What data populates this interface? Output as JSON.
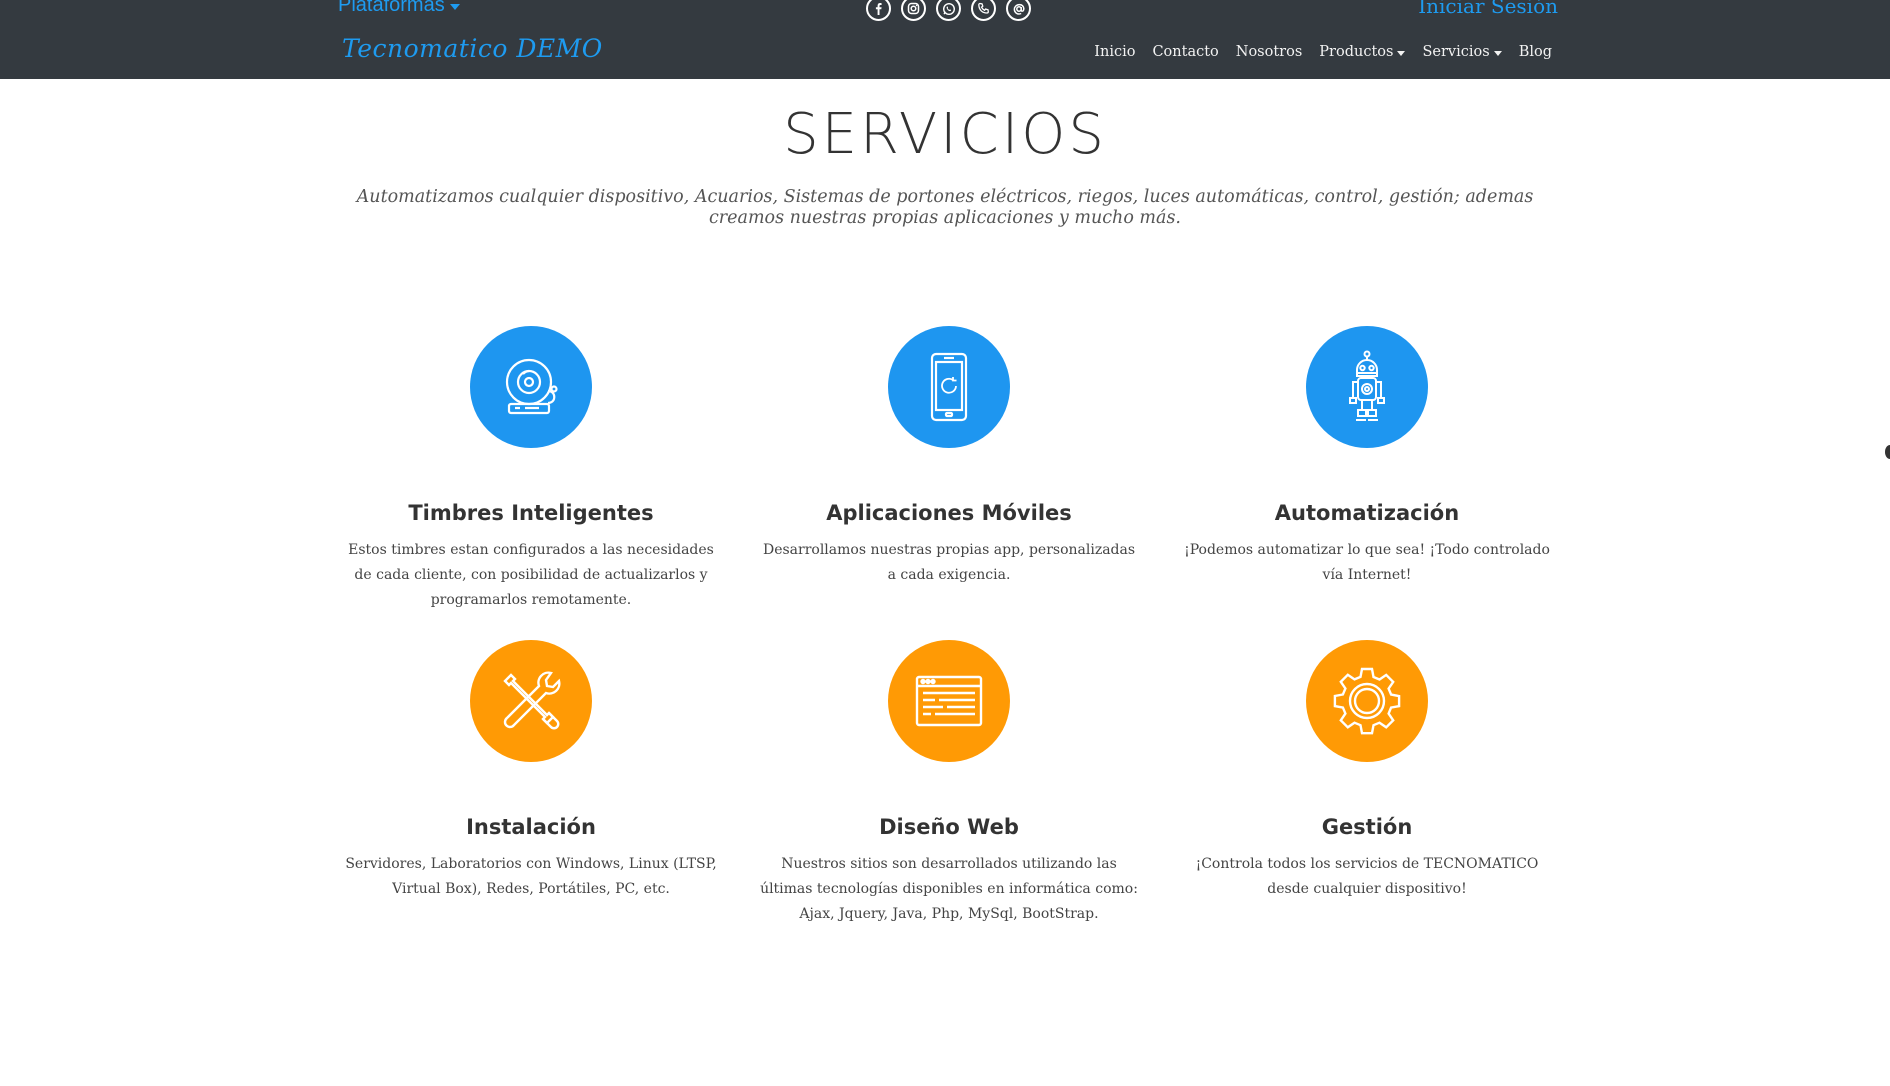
{
  "header": {
    "plataformas_label": "Plataformas",
    "login_label": "Iniciar Sesión",
    "brand": "Tecnomatico DEMO",
    "social_icons": [
      "facebook-icon",
      "instagram-icon",
      "whatsapp-icon",
      "phone-icon",
      "email-icon"
    ],
    "nav": [
      {
        "label": "Inicio",
        "dropdown": false
      },
      {
        "label": "Contacto",
        "dropdown": false
      },
      {
        "label": "Nosotros",
        "dropdown": false
      },
      {
        "label": "Productos",
        "dropdown": true
      },
      {
        "label": "Servicios",
        "dropdown": true
      },
      {
        "label": "Blog",
        "dropdown": false
      }
    ]
  },
  "main": {
    "title": "SERVICIOS",
    "intro": "Automatizamos cualquier dispositivo, Acuarios, Sistemas de portones eléctricos, riegos, luces automáticas, control, gestión; ademas creamos nuestras propias aplicaciones y mucho más."
  },
  "services": [
    {
      "icon": "bell-icon",
      "color": "#1e96f0",
      "title": "Timbres Inteligentes",
      "desc": "Estos timbres estan configurados a las necesidades de cada cliente, con posibilidad de actualizarlos y programarlos remotamente."
    },
    {
      "icon": "smartphone-icon",
      "color": "#1e96f0",
      "title": "Aplicaciones Móviles",
      "desc": "Desarrollamos nuestras propias app, personalizadas a cada exigencia."
    },
    {
      "icon": "robot-icon",
      "color": "#1e96f0",
      "title": "Automatización",
      "desc": "¡Podemos automatizar lo que sea! ¡Todo controlado vía Internet!"
    },
    {
      "icon": "tools-icon",
      "color": "#ff9a05",
      "title": "Instalación",
      "desc": "Servidores, Laboratorios con Windows, Linux (LTSP, Virtual Box), Redes, Portátiles, PC, etc."
    },
    {
      "icon": "web-window-icon",
      "color": "#ff9a05",
      "title": "Diseño Web",
      "desc": "Nuestros sitios son desarrollados utilizando las últimas tecnologías disponibles en informática como: Ajax, Jquery, Java, Php, MySql, BootStrap."
    },
    {
      "icon": "gear-icon",
      "color": "#ff9a05",
      "title": "Gestión",
      "desc": "¡Controla todos los servicios de TECNOMATICO desde cualquier dispositivo!"
    }
  ],
  "colors": {
    "nav_bg": "#343a40",
    "accent": "#1e9bf0",
    "blue": "#1e96f0",
    "orange": "#ff9a05"
  }
}
